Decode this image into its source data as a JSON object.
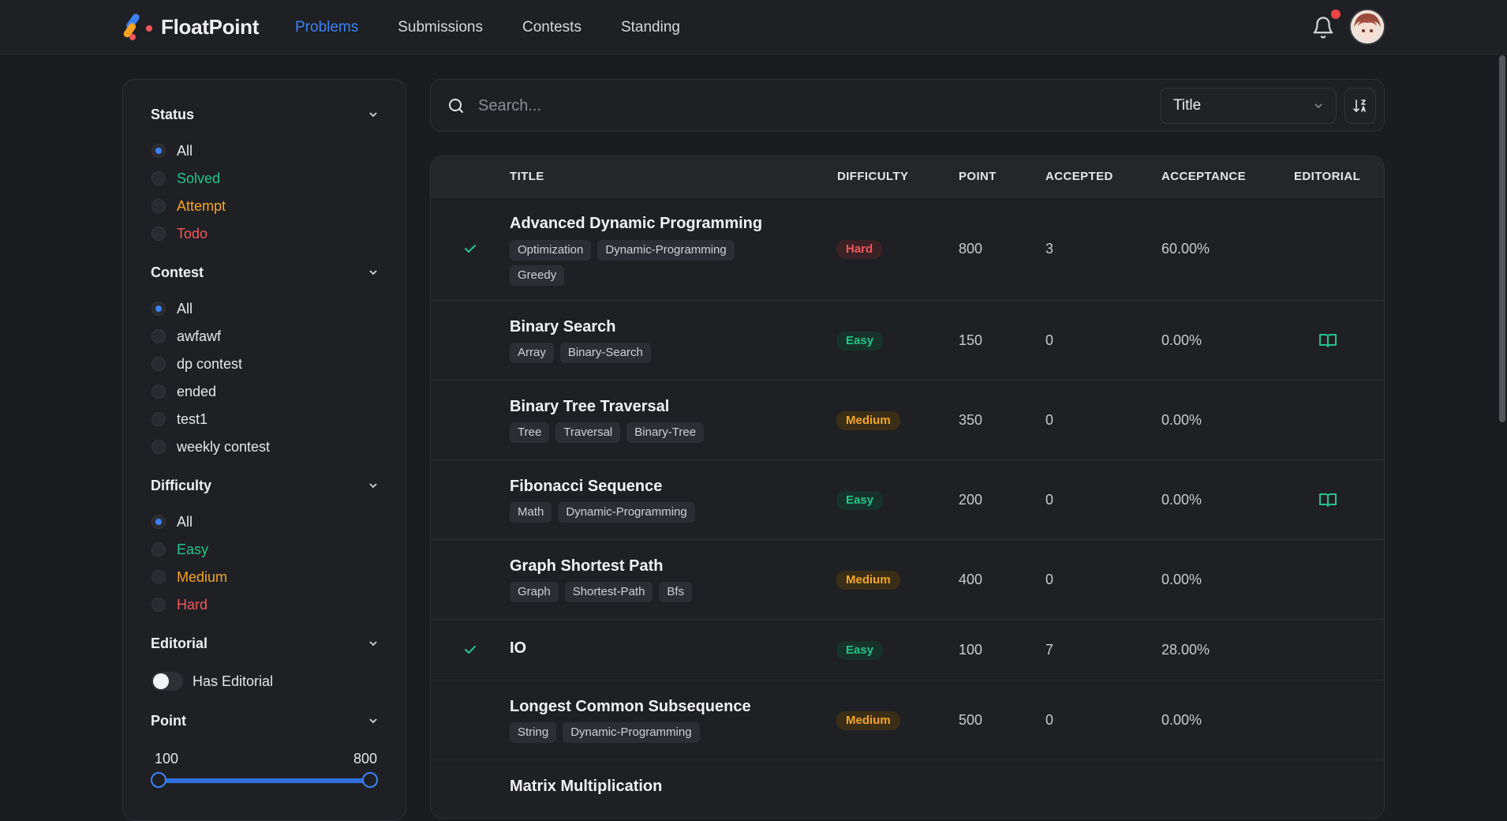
{
  "brand": {
    "name": "FloatPoint"
  },
  "nav": {
    "items": [
      {
        "label": "Problems",
        "active": true
      },
      {
        "label": "Submissions",
        "active": false
      },
      {
        "label": "Contests",
        "active": false
      },
      {
        "label": "Standing",
        "active": false
      }
    ]
  },
  "header": {
    "notification_icon": "bell-icon",
    "has_notification": true,
    "avatar": "user-avatar"
  },
  "sidebar": {
    "status": {
      "title": "Status",
      "options": [
        {
          "label": "All",
          "selected": true,
          "color": "#e6e6ea"
        },
        {
          "label": "Solved",
          "selected": false,
          "color": "#22c58b"
        },
        {
          "label": "Attempt",
          "selected": false,
          "color": "#f5a524"
        },
        {
          "label": "Todo",
          "selected": false,
          "color": "#f0575c"
        }
      ]
    },
    "contest": {
      "title": "Contest",
      "options": [
        {
          "label": "All",
          "selected": true
        },
        {
          "label": "awfawf",
          "selected": false
        },
        {
          "label": "dp contest",
          "selected": false
        },
        {
          "label": "ended",
          "selected": false
        },
        {
          "label": "test1",
          "selected": false
        },
        {
          "label": "weekly contest",
          "selected": false
        }
      ]
    },
    "difficulty": {
      "title": "Difficulty",
      "options": [
        {
          "label": "All",
          "selected": true,
          "color": "#e6e6ea"
        },
        {
          "label": "Easy",
          "selected": false,
          "color": "#22c58b"
        },
        {
          "label": "Medium",
          "selected": false,
          "color": "#f5a524"
        },
        {
          "label": "Hard",
          "selected": false,
          "color": "#f0575c"
        }
      ]
    },
    "editorial": {
      "title": "Editorial",
      "toggle_label": "Has Editorial",
      "toggle_on": false
    },
    "point": {
      "title": "Point",
      "min": "100",
      "max": "800"
    }
  },
  "search": {
    "placeholder": "Search...",
    "value": ""
  },
  "sort": {
    "selected": "Title"
  },
  "table": {
    "headers": [
      "TITLE",
      "DIFFICULTY",
      "POINT",
      "ACCEPTED",
      "ACCEPTANCE",
      "EDITORIAL"
    ],
    "rows": [
      {
        "solved": true,
        "title": "Advanced Dynamic Programming",
        "tags": [
          "Optimization",
          "Dynamic-Programming",
          "Greedy"
        ],
        "difficulty": "Hard",
        "point": "800",
        "accepted": "3",
        "acceptance": "60.00%",
        "editorial": false
      },
      {
        "solved": false,
        "title": "Binary Search",
        "tags": [
          "Array",
          "Binary-Search"
        ],
        "difficulty": "Easy",
        "point": "150",
        "accepted": "0",
        "acceptance": "0.00%",
        "editorial": true
      },
      {
        "solved": false,
        "title": "Binary Tree Traversal",
        "tags": [
          "Tree",
          "Traversal",
          "Binary-Tree"
        ],
        "difficulty": "Medium",
        "point": "350",
        "accepted": "0",
        "acceptance": "0.00%",
        "editorial": false
      },
      {
        "solved": false,
        "title": "Fibonacci Sequence",
        "tags": [
          "Math",
          "Dynamic-Programming"
        ],
        "difficulty": "Easy",
        "point": "200",
        "accepted": "0",
        "acceptance": "0.00%",
        "editorial": true
      },
      {
        "solved": false,
        "title": "Graph Shortest Path",
        "tags": [
          "Graph",
          "Shortest-Path",
          "Bfs"
        ],
        "difficulty": "Medium",
        "point": "400",
        "accepted": "0",
        "acceptance": "0.00%",
        "editorial": false
      },
      {
        "solved": true,
        "title": "IO",
        "tags": [],
        "difficulty": "Easy",
        "point": "100",
        "accepted": "7",
        "acceptance": "28.00%",
        "editorial": false
      },
      {
        "solved": false,
        "title": "Longest Common Subsequence",
        "tags": [
          "String",
          "Dynamic-Programming"
        ],
        "difficulty": "Medium",
        "point": "500",
        "accepted": "0",
        "acceptance": "0.00%",
        "editorial": false
      },
      {
        "solved": false,
        "title": "Matrix Multiplication",
        "tags": [],
        "difficulty": "",
        "point": "",
        "accepted": "",
        "acceptance": "",
        "editorial": false
      }
    ]
  },
  "colors": {
    "accent": "#3b82f6",
    "easy": "#22c58b",
    "medium": "#f5a524",
    "hard": "#f0575c"
  }
}
